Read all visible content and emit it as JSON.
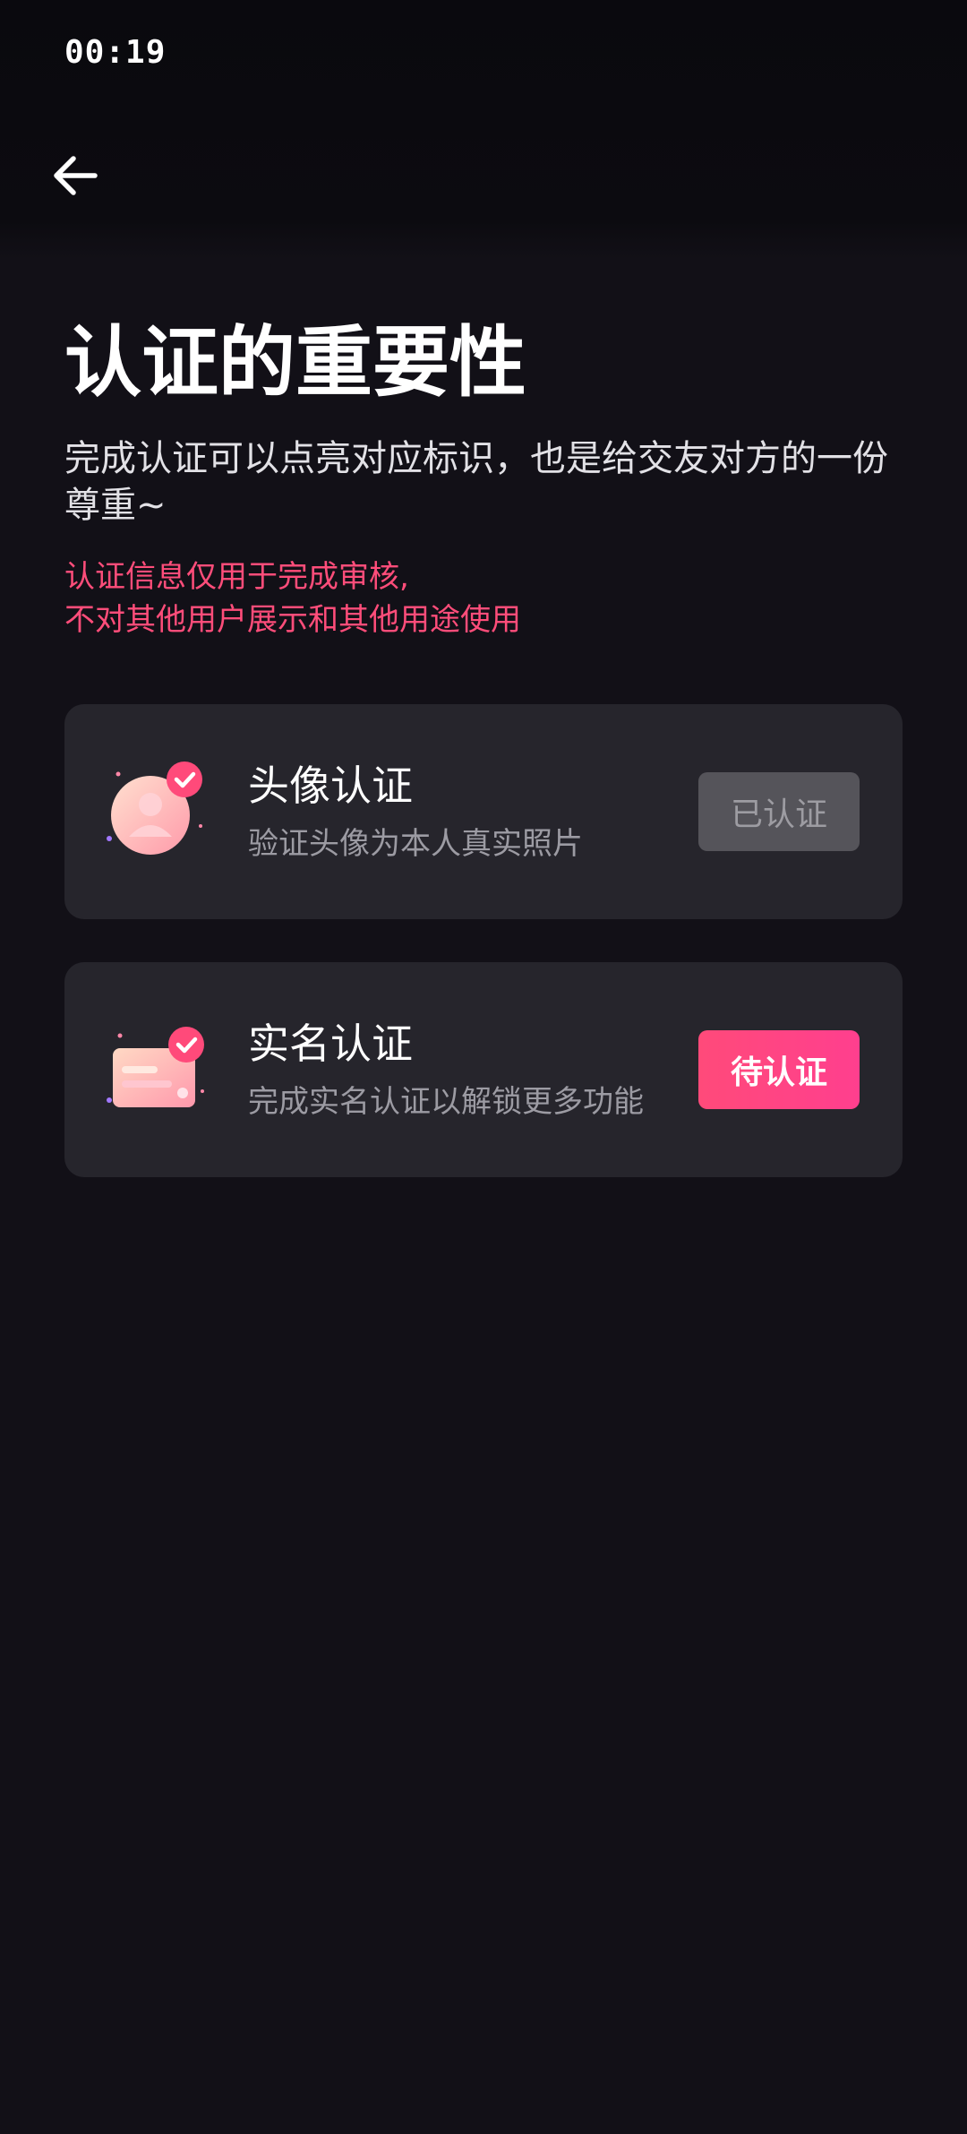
{
  "status_bar": {
    "time": "00:19"
  },
  "nav": {
    "back_icon": "arrow-left-icon"
  },
  "header": {
    "title": "认证的重要性",
    "subtitle": "完成认证可以点亮对应标识，也是给交友对方的一份尊重~",
    "notice_line1": "认证信息仅用于完成审核,",
    "notice_line2": "不对其他用户展示和其他用途使用"
  },
  "cards": [
    {
      "icon": "avatar-verify-icon",
      "title": "头像认证",
      "desc": "验证头像为本人真实照片",
      "button_label": "已认证",
      "status": "verified"
    },
    {
      "icon": "id-card-verify-icon",
      "title": "实名认证",
      "desc": "完成实名认证以解锁更多功能",
      "button_label": "待认证",
      "status": "pending"
    }
  ],
  "colors": {
    "background": "#121017",
    "card": "#26252c",
    "accent_pink": "#ff4a7a",
    "notice_red": "#ff4d7a",
    "disabled_button": "#55545a"
  }
}
